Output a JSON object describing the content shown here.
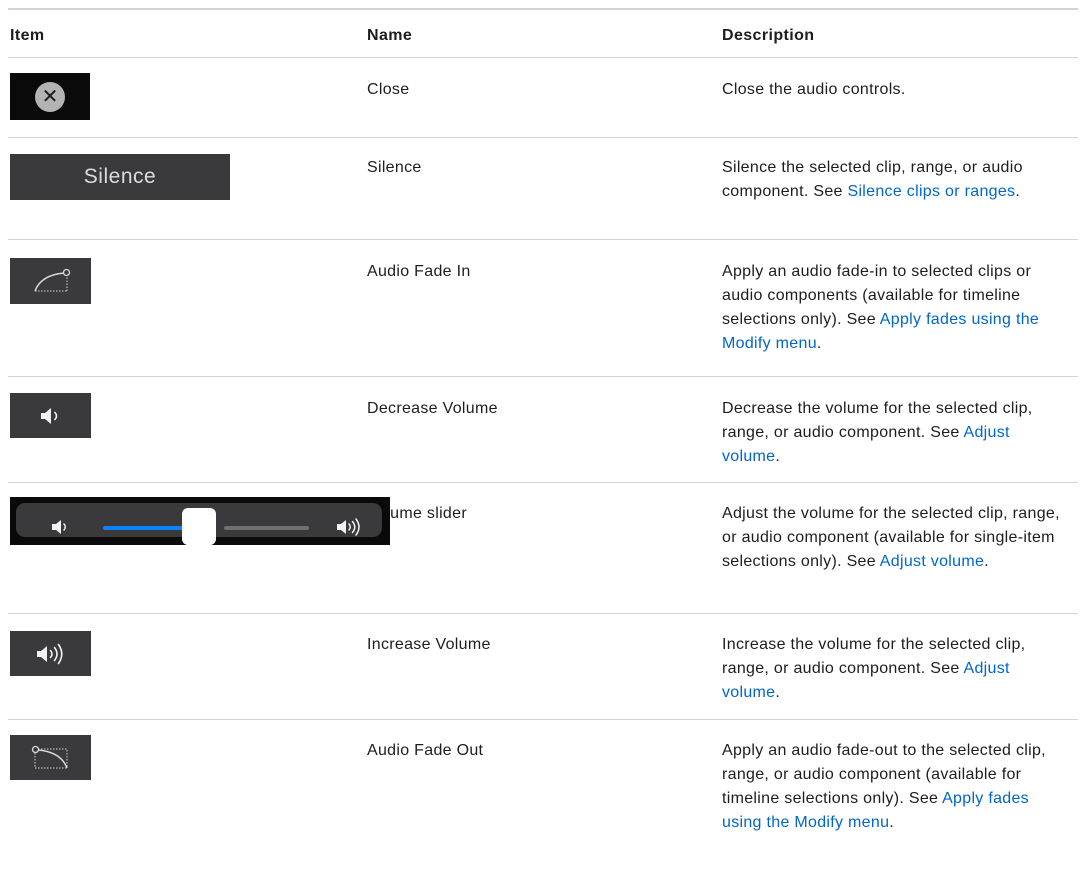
{
  "headers": {
    "item": "Item",
    "name": "Name",
    "description": "Description"
  },
  "rows": [
    {
      "icon": "close-icon",
      "name": "Close",
      "desc": "Close the audio controls."
    },
    {
      "icon": "silence-button",
      "icon_label": "Silence",
      "name": "Silence",
      "desc_before": "Silence the selected clip, range, or audio component. See ",
      "link": "Silence clips or ranges",
      "desc_after": "."
    },
    {
      "icon": "audio-fade-in-icon",
      "name": "Audio Fade In",
      "desc_before": "Apply an audio fade-in to selected clips or audio components (available for timeline selections only). See ",
      "link": "Apply fades using the Modify menu",
      "desc_after": "."
    },
    {
      "icon": "speaker-low-icon",
      "name": "Decrease Volume",
      "desc_before": "Decrease the volume for the selected clip, range, or audio component. See ",
      "link": "Adjust volume",
      "desc_after": "."
    },
    {
      "icon": "volume-slider",
      "slider_level": 0.48,
      "name": "Volume slider",
      "desc_before": "Adjust the volume for the selected clip, range, or audio component (available for single-item selections only). See ",
      "link": "Adjust volume",
      "desc_after": "."
    },
    {
      "icon": "speaker-high-icon",
      "name": "Increase Volume",
      "desc_before": "Increase the volume for the selected clip, range, or audio component. See ",
      "link": "Adjust volume",
      "desc_after": "."
    },
    {
      "icon": "audio-fade-out-icon",
      "name": "Audio Fade Out",
      "desc_before": "Apply an audio fade-out to the selected clip, range, or audio component (available for timeline selections only). See ",
      "link": "Apply fades using the Modify menu",
      "desc_after": "."
    }
  ],
  "colors": {
    "link": "#0066cc",
    "slider_accent": "#0a84ff",
    "icon_bg": "#3a3a3c"
  }
}
